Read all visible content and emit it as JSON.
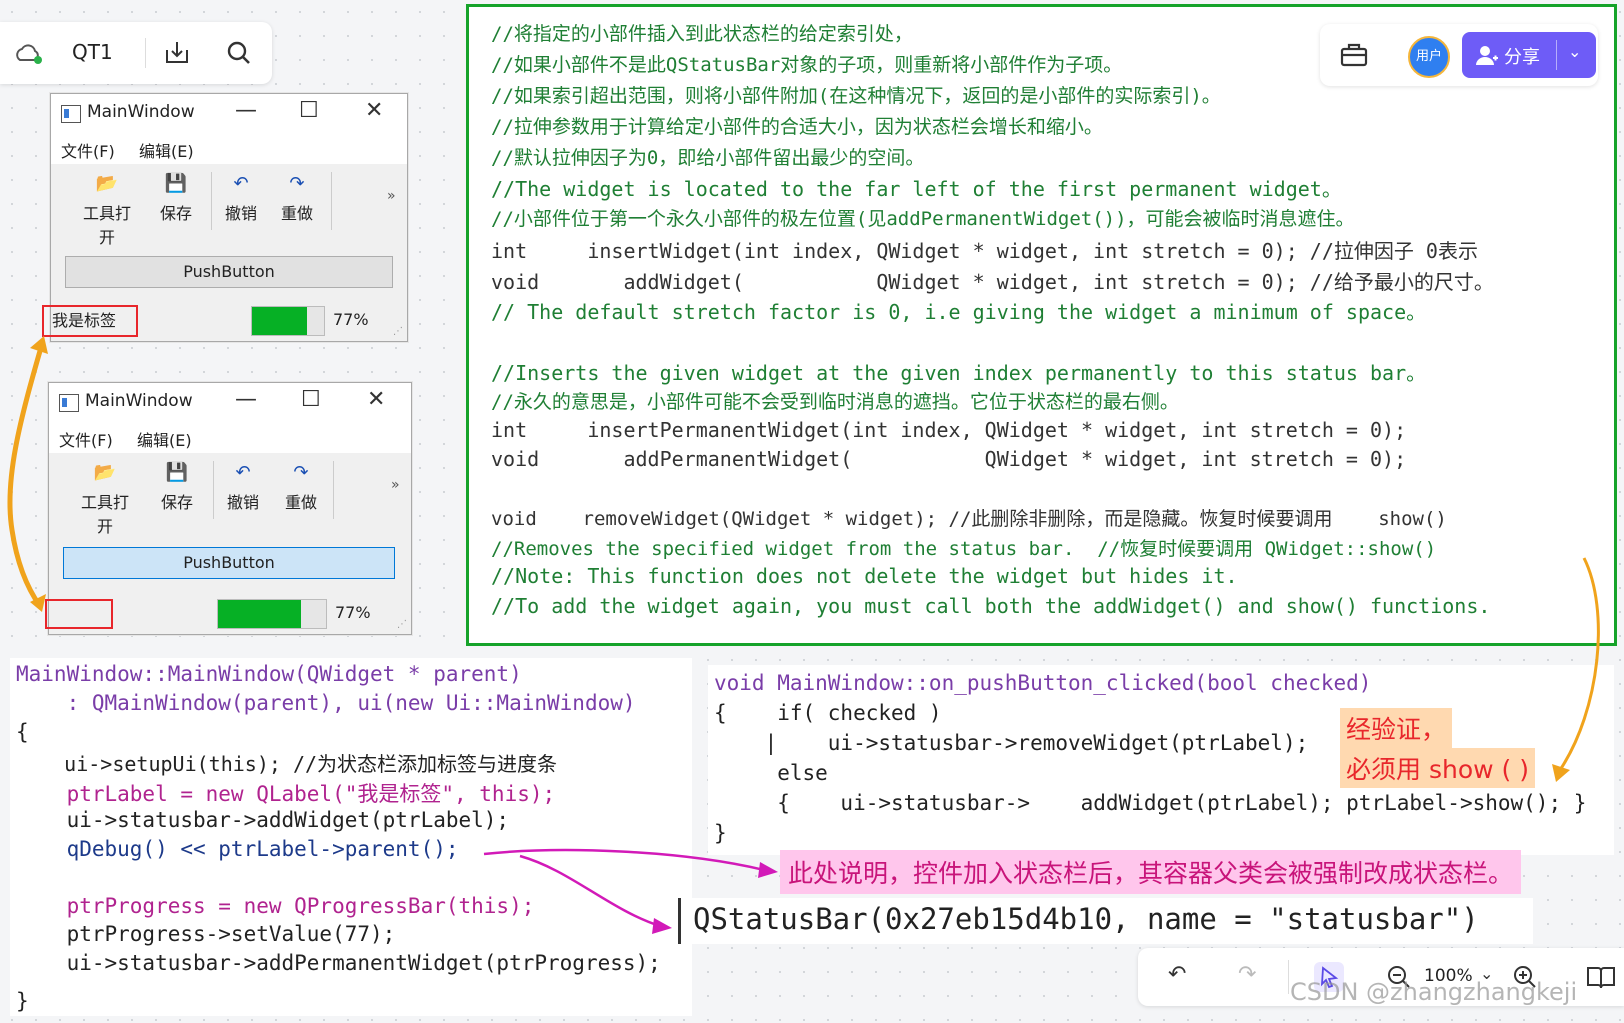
{
  "app": {
    "doc_title": "QT1",
    "icons": [
      "cloud-sync-icon",
      "download-icon",
      "search-icon"
    ]
  },
  "window": {
    "title": "MainWindow",
    "controls": {
      "minimize": "—",
      "maximize": "☐",
      "close": "✕"
    },
    "menus": [
      "文件(F)",
      "编辑(E)"
    ],
    "toolbar": [
      {
        "label": "工具打开",
        "icon": "folder-icon"
      },
      {
        "label": "保存",
        "icon": "save-icon"
      },
      {
        "label": "撤销",
        "icon": "undo-icon"
      },
      {
        "label": "重做",
        "icon": "redo-icon"
      }
    ],
    "more": "»",
    "pushbutton": "PushButton",
    "status_label": "我是标签",
    "progress": {
      "value": 77,
      "text": "77%"
    }
  },
  "header": {
    "avatar": "用户",
    "share": "分享",
    "share_dropdown": "⌄"
  },
  "green_code": [
    "//将指定的小部件插入到此状态栏的给定索引处，",
    "//如果小部件不是此QStatusBar对象的子项，则重新将小部件作为子项。",
    "//如果索引超出范围，则将小部件附加(在这种情况下，返回的是小部件的实际索引)。",
    "//拉伸参数用于计算给定小部件的合适大小，因为状态栏会增长和缩小。",
    "//默认拉伸因子为0，即给小部件留出最少的空间。",
    "//The widget is located to the far left of the first permanent widget。",
    "//小部件位于第一个永久小部件的极左位置(见addPermanentWidget())，可能会被临时消息遮住。",
    "int     insertWidget(int index, QWidget * widget, int stretch = 0); //拉伸因子 0表示",
    "void       addWidget(           QWidget * widget, int stretch = 0); //给予最小的尺寸。",
    "// The default stretch factor is 0, i.e giving the widget a minimum of space。",
    "//Inserts the given widget at the given index permanently to this status bar。",
    "//永久的意思是，小部件可能不会受到临时消息的遮挡。它位于状态栏的最右侧。",
    "int     insertPermanentWidget(int index, QWidget * widget, int stretch = 0);",
    "void       addPermanentWidget(           QWidget * widget, int stretch = 0);",
    "void    removeWidget(QWidget * widget); //此删除非删除，而是隐藏。恢复时候要调用    show()",
    "//Removes the specified widget from the status bar.  //恢复时候要调用 QWidget::show()",
    "//Note: This function does not delete the widget but hides it.",
    "//To add the widget again, you must call both the addWidget() and show() functions."
  ],
  "ctor_code": [
    "MainWindow::MainWindow(QWidget * parent)",
    "    : QMainWindow(parent), ui(new Ui::MainWindow)",
    "{",
    "    ui->setupUi(this); //为状态栏添加标签与进度条",
    "    ptrLabel = new QLabel(\"我是标签\", this);",
    "    ui->statusbar->addWidget(ptrLabel);",
    "    qDebug() << ptrLabel->parent();",
    "",
    "    ptrProgress = new QProgressBar(this);",
    "    ptrProgress->setValue(77);",
    "    ui->statusbar->addPermanentWidget(ptrProgress);",
    "}"
  ],
  "slot_code": [
    "void MainWindow::on_pushButton_clicked(bool checked)",
    "{    if( checked )",
    "    |    ui->statusbar->removeWidget(ptrLabel);",
    "     else",
    "     {    ui->statusbar->    addWidget(ptrLabel); ptrLabel->show(); }",
    "}"
  ],
  "notes": {
    "verify_line1": "经验证，",
    "verify_line2": "必须用 show ( )",
    "parent_note": "此处说明，控件加入状态栏后，其容器父类会被强制改成状态栏。",
    "debug_output": "QStatusBar(0x27eb15d4b10, name = \"statusbar\")"
  },
  "bottom_toolbar": {
    "zoom": "100%",
    "icons": [
      "undo-icon",
      "redo-icon",
      "pointer-icon",
      "zoom-out-icon",
      "zoom-in-icon",
      "book-icon"
    ]
  },
  "watermark": "CSDN @zhangzhangkeji",
  "colors": {
    "green_border": "#16a32a",
    "red_box": "#e8262b",
    "orange_arrow": "#f0a31c",
    "magenta_arrow": "#d21ab8",
    "progress": "#06b025",
    "share": "#6e5cf7"
  }
}
